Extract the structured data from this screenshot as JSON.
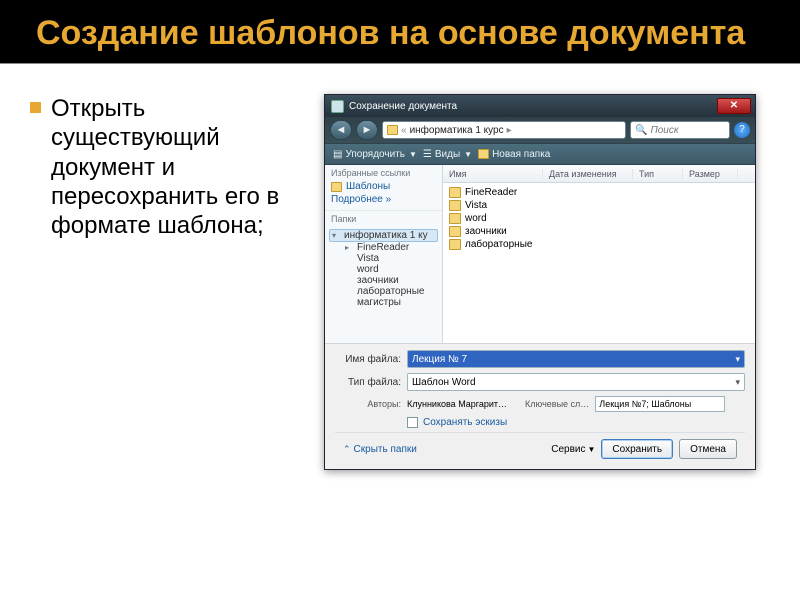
{
  "slide": {
    "title": "Создание шаблонов на основе документа",
    "bullet": "Открыть существующий документ и пересохранить его в формате шаблона;"
  },
  "dialog": {
    "title": "Сохранение документа",
    "breadcrumb": {
      "item": "информатика 1 курс"
    },
    "search_placeholder": "Поиск",
    "toolbar": {
      "organize": "Упорядочить",
      "views": "Виды",
      "new_folder": "Новая папка"
    },
    "nav": {
      "fav_links_header": "Избранные ссылки",
      "templates": "Шаблоны",
      "more": "Подробнее »",
      "folders_header": "Папки",
      "tree": {
        "root": "информатика 1 ку",
        "items": [
          "FineReader",
          "Vista",
          "word",
          "заочники",
          "лабораторные",
          "магистры"
        ]
      }
    },
    "columns": {
      "name": "Имя",
      "date": "Дата изменения",
      "type": "Тип",
      "size": "Размер"
    },
    "files": [
      "FineReader",
      "Vista",
      "word",
      "заочники",
      "лабораторные"
    ],
    "filename_label": "Имя файла:",
    "filename_value": "Лекция № 7",
    "filetype_label": "Тип файла:",
    "filetype_value": "Шаблон Word",
    "authors_label": "Авторы:",
    "authors_value": "Клунникова Маргарит…",
    "keywords_label": "Ключевые сл…",
    "keywords_value": "Лекция №7; Шаблоны",
    "save_thumbs": "Сохранять эскизы",
    "hide_folders": "Скрыть папки",
    "service": "Сервис",
    "save": "Сохранить",
    "cancel": "Отмена"
  }
}
